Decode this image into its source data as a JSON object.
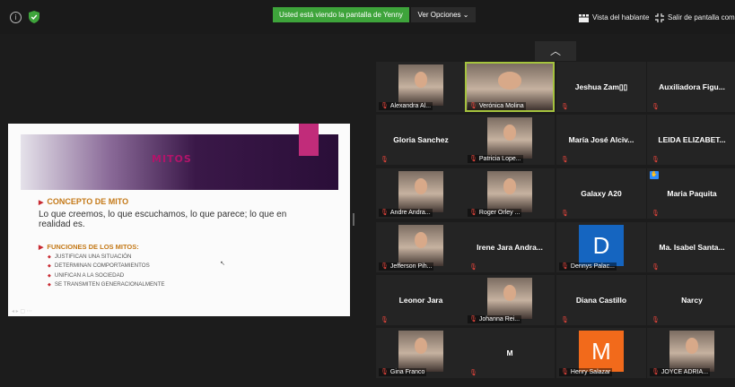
{
  "toolbar": {
    "sharing_banner": "Usted está viendo la pantalla de Yenny",
    "view_options": "Ver Opciones",
    "speaker_view": "Vista del hablante",
    "exit_fullscreen": "Salir de pantalla comp"
  },
  "slide": {
    "title": "MITOS",
    "concept_heading": "CONCEPTO DE MITO",
    "concept_text": "Lo que creemos, lo que escuchamos, lo que parece; lo que en realidad es.",
    "functions_heading": "FUNCIONES DE LOS MITOS:",
    "functions": [
      "JUSTIFICAN UNA SITUACIÓN",
      "DETERMINAN COMPORTAMIENTOS",
      "UNIFICAN A LA SOCIEDAD",
      "SE TRANSMITEN GENERACIONALMENTE"
    ]
  },
  "participants": [
    {
      "label": "Alexandra Al...",
      "video": true
    },
    {
      "label": "Verónica Molina",
      "video": true,
      "active": true
    },
    {
      "name": "Jeshua Zam▯▯"
    },
    {
      "name": "Auxiliadora Figu..."
    },
    {
      "name": "Gloria Sanchez"
    },
    {
      "label": "Patricia Lope...",
      "video": true
    },
    {
      "name": "María José Alciv..."
    },
    {
      "name": "LEIDA ELIZABET..."
    },
    {
      "label": "Andre Andra...",
      "video": true
    },
    {
      "label": "Roger Orley ...",
      "video": true
    },
    {
      "name": "Galaxy A20"
    },
    {
      "name": "Maria Paquita",
      "hand": true
    },
    {
      "label": "Jefferson Pih...",
      "video": true
    },
    {
      "name": "Irene Jara Andra..."
    },
    {
      "label": "Dennys Palac...",
      "avatar": "D",
      "avatar_color": "#1565c0"
    },
    {
      "name": "Ma. Isabel Santa..."
    },
    {
      "name": "Leonor Jara"
    },
    {
      "label": "Johanna Rei...",
      "video": true
    },
    {
      "name": "Diana Castillo"
    },
    {
      "name": "Narcy"
    },
    {
      "label": "Gina Franco",
      "video": true
    },
    {
      "name": "M"
    },
    {
      "label": "Henry Salazar",
      "avatar": "M",
      "avatar_color": "#f26a1b"
    },
    {
      "label": "JOYCE ADRIA...",
      "video": true
    }
  ]
}
